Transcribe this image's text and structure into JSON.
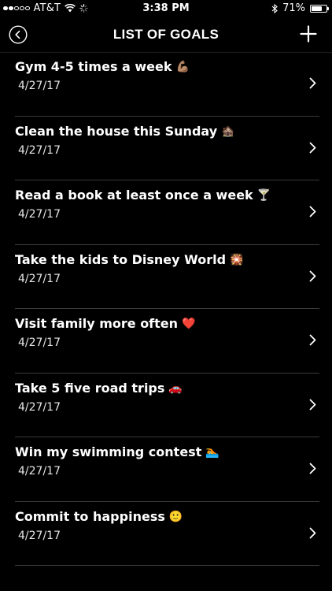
{
  "status_bar": {
    "carrier": "AT&T",
    "time": "3:38 PM",
    "battery": "71%",
    "battery_level": 0.71,
    "signal_bars_filled": 2,
    "signal_bars_total": 5,
    "icons": [
      "signal-icon",
      "wifi-icon",
      "activity-spinner-icon",
      "bluetooth-icon",
      "battery-icon"
    ]
  },
  "nav": {
    "title": "LIST OF GOALS",
    "back_icon": "back-circle-icon",
    "add_icon": "plus-icon"
  },
  "goals": [
    {
      "title": "Gym 4-5 times a week",
      "emoji": "💪🏽",
      "date": "4/27/17"
    },
    {
      "title": "Clean the house this Sunday",
      "emoji": "🏚️",
      "date": "4/27/17"
    },
    {
      "title": "Read a book at least once a week",
      "emoji": "🍸",
      "date": "4/27/17"
    },
    {
      "title": "Take the kids to Disney World",
      "emoji": "🎇",
      "date": "4/27/17"
    },
    {
      "title": "Visit family more often",
      "emoji": "❤️",
      "date": "4/27/17"
    },
    {
      "title": "Take 5 five road trips",
      "emoji": "🚗",
      "date": "4/27/17"
    },
    {
      "title": "Win my swimming contest",
      "emoji": "🏊",
      "date": "4/27/17"
    },
    {
      "title": "Commit to happiness",
      "emoji": "🙂",
      "date": "4/27/17"
    }
  ],
  "colors": {
    "background": "#000000",
    "text": "#ffffff",
    "separator": "#3a3a3a"
  }
}
